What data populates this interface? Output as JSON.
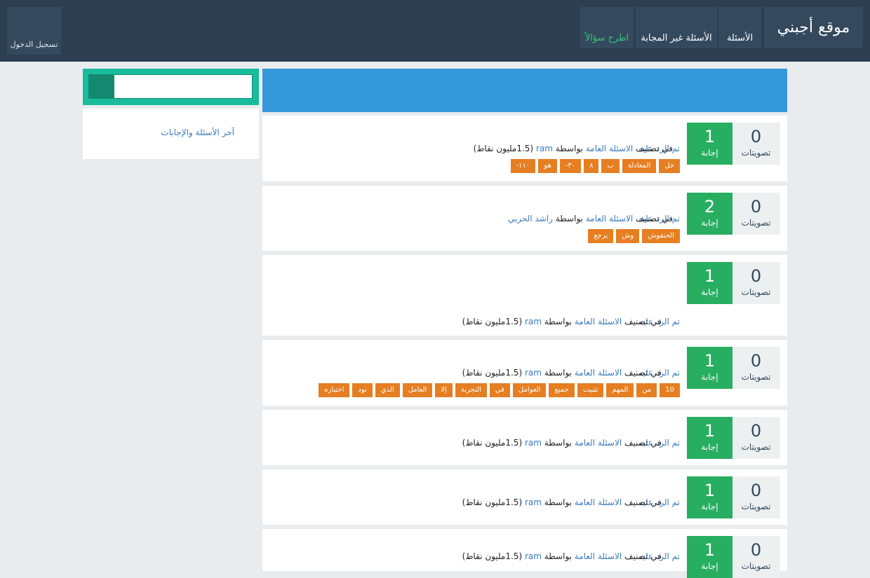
{
  "header": {
    "site_title": "موقع أجبني",
    "nav": {
      "questions": "الأسئلة",
      "unanswered": "الأسئلة غير المجابة",
      "ask": "اطرح سؤالاً"
    },
    "login": "تسجيل الدخول"
  },
  "sidebar": {
    "search_placeholder": "",
    "latest_link": "آخر الأسئلة والإجابات"
  },
  "labels": {
    "votes": "تصويتات",
    "answer": "إجابة",
    "answered": "تم الرد عليه",
    "in_category": "في تصنيف",
    "by": "بواسطة"
  },
  "questions": [
    {
      "votes": "0",
      "answers": "1",
      "category": "الاسئلة العامة",
      "user": "ram",
      "points": "(1.5مليون نقاط)",
      "tags": [
        "حل",
        "المعادلة",
        "ب",
        "٨",
        "٣٠-",
        "هو",
        "١١٠-"
      ]
    },
    {
      "votes": "0",
      "answers": "2",
      "category": "الاسئلة العامة",
      "user": "راشد الحربي",
      "points": "",
      "tags": [
        "الحنفوش",
        "وش",
        "يرجع"
      ]
    },
    {
      "votes": "0",
      "answers": "1",
      "category": "الاسئلة العامة",
      "user": "ram",
      "points": "(1.5مليون نقاط)",
      "tags": []
    },
    {
      "votes": "0",
      "answers": "1",
      "category": "الاسئلة العامة",
      "user": "ram",
      "points": "(1.5مليون نقاط)",
      "tags": [
        "10",
        "من",
        "المهم",
        "تثبيت",
        "جميع",
        "العوامل",
        "في",
        "التجربة",
        "إلا",
        "العامل",
        "الذي",
        "نود",
        "اختباره"
      ]
    },
    {
      "votes": "0",
      "answers": "1",
      "category": "الاسئلة العامة",
      "user": "ram",
      "points": "(1.5مليون نقاط)",
      "tags": []
    },
    {
      "votes": "0",
      "answers": "1",
      "category": "الاسئلة العامة",
      "user": "ram",
      "points": "(1.5مليون نقاط)",
      "tags": []
    },
    {
      "votes": "0",
      "answers": "1",
      "category": "الاسئلة العامة",
      "user": "ram",
      "points": "(1.5مليون نقاط)",
      "tags": []
    }
  ]
}
